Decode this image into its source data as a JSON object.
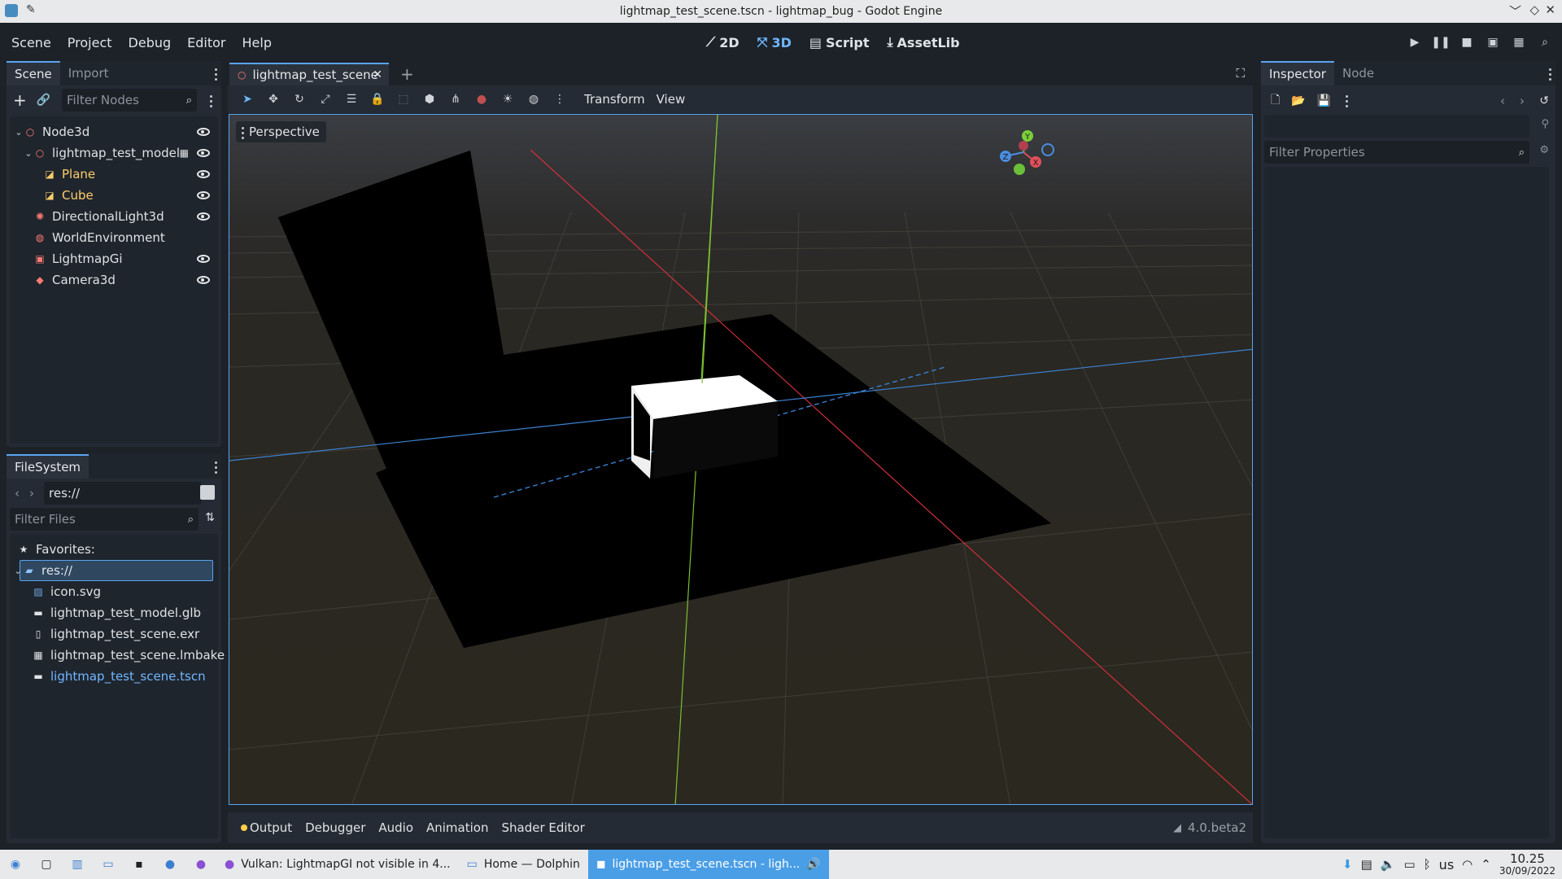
{
  "window": {
    "title": "lightmap_test_scene.tscn - lightmap_bug - Godot Engine"
  },
  "menu": [
    "Scene",
    "Project",
    "Debug",
    "Editor",
    "Help"
  ],
  "workspaces": [
    {
      "label": "2D",
      "icon": "2d-icon"
    },
    {
      "label": "3D",
      "icon": "3d-icon",
      "active": true
    },
    {
      "label": "Script",
      "icon": "script-icon"
    },
    {
      "label": "AssetLib",
      "icon": "assetlib-icon"
    }
  ],
  "scene_dock": {
    "tabs": [
      "Scene",
      "Import"
    ],
    "filter_placeholder": "Filter Nodes",
    "nodes": [
      {
        "label": "Node3d",
        "depth": 0,
        "icon": "node3d-icon",
        "color": "#ff7b73",
        "eye": true,
        "expanded": true
      },
      {
        "label": "lightmap_test_model",
        "depth": 1,
        "icon": "node3d-icon",
        "color": "#ff7b73",
        "eye": true,
        "expanded": true,
        "scene_icon": true
      },
      {
        "label": "Plane",
        "depth": 2,
        "icon": "mesh-instance-icon",
        "color": "#ffce6a",
        "eye": true
      },
      {
        "label": "Cube",
        "depth": 2,
        "icon": "mesh-instance-icon",
        "color": "#ffce6a",
        "eye": true
      },
      {
        "label": "DirectionalLight3d",
        "depth": 1,
        "icon": "light-icon",
        "color": "#ff7b73",
        "eye": true
      },
      {
        "label": "WorldEnvironment",
        "depth": 1,
        "icon": "globe-icon",
        "color": "#ff7b73",
        "eye": false
      },
      {
        "label": "LightmapGi",
        "depth": 1,
        "icon": "lightmap-icon",
        "color": "#ff7b73",
        "eye": true
      },
      {
        "label": "Camera3d",
        "depth": 1,
        "icon": "camera-icon",
        "color": "#ff7b73",
        "eye": true
      }
    ]
  },
  "filesystem": {
    "tab": "FileSystem",
    "path": "res://",
    "filter_placeholder": "Filter Files",
    "favorites": "Favorites:",
    "root": "res://",
    "files": [
      {
        "label": "icon.svg",
        "icon": "image-icon",
        "highlight": false
      },
      {
        "label": "lightmap_test_model.glb",
        "icon": "scene-file-icon",
        "highlight": false
      },
      {
        "label": "lightmap_test_scene.exr",
        "icon": "file-icon",
        "highlight": false
      },
      {
        "label": "lightmap_test_scene.lmbake",
        "icon": "lmbake-file-icon",
        "highlight": false
      },
      {
        "label": "lightmap_test_scene.tscn",
        "icon": "scene-file-icon",
        "highlight": true
      }
    ]
  },
  "editor": {
    "tab_label": "lightmap_test_scene",
    "toolbar_menus": [
      "Transform",
      "View"
    ],
    "perspective_label": "Perspective",
    "gizmo": {
      "y": "Y",
      "x": "X",
      "z": "Z"
    }
  },
  "inspector": {
    "tabs": [
      "Inspector",
      "Node"
    ],
    "filter_placeholder": "Filter Properties"
  },
  "bottom_panel": {
    "items": [
      "Output",
      "Debugger",
      "Audio",
      "Animation",
      "Shader Editor"
    ],
    "version": "4.0.beta2"
  },
  "taskbar": {
    "tasks": [
      {
        "label": "Vulkan: LightmapGI not visible in 4...",
        "active": false
      },
      {
        "label": "Home — Dolphin",
        "active": false
      },
      {
        "label": "lightmap_test_scene.tscn - ligh...",
        "active": true
      }
    ],
    "keyboard_layout": "us",
    "time": "10.25",
    "date": "30/09/2022"
  },
  "colors": {
    "accent": "#5aa4f0",
    "node_red": "#ff7b73",
    "mesh_yellow": "#ffce6a",
    "panel_bg": "#252b34",
    "editor_bg": "#1d2229"
  }
}
